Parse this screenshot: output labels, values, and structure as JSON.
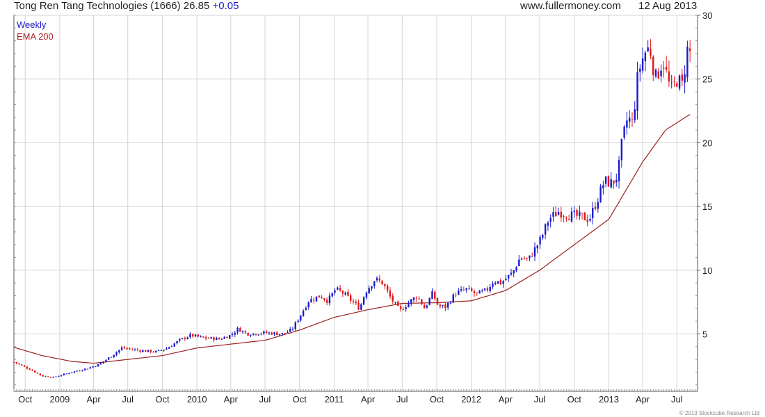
{
  "header": {
    "title": "Tong Ren Tang Technologies (1666) 26.85",
    "change": "+0.05",
    "website": "www.fullermoney.com",
    "date": "12 Aug 2013"
  },
  "legend": {
    "weekly": "Weekly",
    "ema": "EMA 200"
  },
  "copyright": "© 2013 Stockcube Research Ltd",
  "colors": {
    "up": "#1a1acc",
    "down": "#e01818",
    "ema": "#9a2020",
    "grid": "#d4d4d4"
  },
  "chart_data": {
    "type": "candlestick",
    "y_ticks": [
      5,
      10,
      15,
      20,
      25,
      30
    ],
    "ylim": [
      0.5,
      30
    ],
    "x_tick_labels": [
      "Oct",
      "2009",
      "Apr",
      "Jul",
      "Oct",
      "2010",
      "Apr",
      "Jul",
      "Oct",
      "2011",
      "Apr",
      "Jul",
      "Oct",
      "2012",
      "Apr",
      "Jul",
      "Oct",
      "2013",
      "Apr",
      "Jul"
    ],
    "x_tick_dates": [
      "2008-10-01",
      "2009-01-01",
      "2009-04-01",
      "2009-07-01",
      "2009-10-01",
      "2010-01-01",
      "2010-04-01",
      "2010-07-01",
      "2010-10-01",
      "2011-01-01",
      "2011-04-01",
      "2011-07-01",
      "2011-10-01",
      "2012-01-01",
      "2012-04-01",
      "2012-07-01",
      "2012-10-01",
      "2013-01-01",
      "2013-04-01",
      "2013-07-01"
    ],
    "xlim": [
      "2008-09-01",
      "2013-08-25"
    ],
    "grid": true,
    "price_keypoints": [
      [
        "2008-09-01",
        2.8
      ],
      [
        "2008-10-15",
        2.2
      ],
      [
        "2008-11-15",
        1.7
      ],
      [
        "2008-12-15",
        1.6
      ],
      [
        "2009-02-01",
        2.0
      ],
      [
        "2009-03-15",
        2.3
      ],
      [
        "2009-04-15",
        2.6
      ],
      [
        "2009-05-15",
        3.2
      ],
      [
        "2009-06-15",
        3.9
      ],
      [
        "2009-08-01",
        3.7
      ],
      [
        "2009-09-15",
        3.6
      ],
      [
        "2009-10-15",
        3.9
      ],
      [
        "2009-11-15",
        4.5
      ],
      [
        "2009-12-15",
        4.9
      ],
      [
        "2010-01-15",
        4.7
      ],
      [
        "2010-03-01",
        4.6
      ],
      [
        "2010-04-01",
        4.9
      ],
      [
        "2010-04-20",
        5.4
      ],
      [
        "2010-05-15",
        5.0
      ],
      [
        "2010-07-01",
        5.1
      ],
      [
        "2010-08-15",
        5.0
      ],
      [
        "2010-09-10",
        5.3
      ],
      [
        "2010-09-30",
        6.3
      ],
      [
        "2010-10-25",
        7.6
      ],
      [
        "2010-11-25",
        8.0
      ],
      [
        "2010-12-15",
        7.6
      ],
      [
        "2011-01-05",
        8.5
      ],
      [
        "2011-01-25",
        8.2
      ],
      [
        "2011-02-20",
        7.5
      ],
      [
        "2011-03-10",
        7.0
      ],
      [
        "2011-03-25",
        8.3
      ],
      [
        "2011-04-20",
        9.3
      ],
      [
        "2011-05-10",
        9.0
      ],
      [
        "2011-06-01",
        7.8
      ],
      [
        "2011-06-25",
        6.8
      ],
      [
        "2011-07-20",
        7.5
      ],
      [
        "2011-08-10",
        8.0
      ],
      [
        "2011-08-30",
        7.0
      ],
      [
        "2011-09-20",
        8.2
      ],
      [
        "2011-10-05",
        7.2
      ],
      [
        "2011-10-25",
        7.1
      ],
      [
        "2011-11-20",
        8.2
      ],
      [
        "2011-12-20",
        8.5
      ],
      [
        "2012-01-15",
        8.1
      ],
      [
        "2012-02-10",
        8.4
      ],
      [
        "2012-03-01",
        9.2
      ],
      [
        "2012-03-20",
        9.0
      ],
      [
        "2012-04-20",
        9.8
      ],
      [
        "2012-05-10",
        11.0
      ],
      [
        "2012-06-01",
        10.8
      ],
      [
        "2012-06-15",
        11.5
      ],
      [
        "2012-07-05",
        12.5
      ],
      [
        "2012-07-25",
        14.0
      ],
      [
        "2012-08-20",
        14.6
      ],
      [
        "2012-09-20",
        14.3
      ],
      [
        "2012-10-20",
        14.2
      ],
      [
        "2012-11-10",
        14.0
      ],
      [
        "2012-12-01",
        15.5
      ],
      [
        "2012-12-20",
        17.0
      ],
      [
        "2013-01-10",
        16.8
      ],
      [
        "2013-01-25",
        17.5
      ],
      [
        "2013-02-05",
        20.0
      ],
      [
        "2013-02-20",
        22.0
      ],
      [
        "2013-03-05",
        21.5
      ],
      [
        "2013-03-20",
        25.5
      ],
      [
        "2013-04-05",
        27.0
      ],
      [
        "2013-04-20",
        27.5
      ],
      [
        "2013-05-05",
        25.0
      ],
      [
        "2013-05-25",
        26.5
      ],
      [
        "2013-06-15",
        24.0
      ],
      [
        "2013-07-01",
        25.0
      ],
      [
        "2013-07-15",
        24.5
      ],
      [
        "2013-07-30",
        27.5
      ],
      [
        "2013-08-09",
        26.8
      ]
    ],
    "ema_keypoints": [
      [
        "2008-09-01",
        3.95
      ],
      [
        "2008-11-15",
        3.3
      ],
      [
        "2009-02-01",
        2.85
      ],
      [
        "2009-04-01",
        2.7
      ],
      [
        "2009-07-01",
        3.0
      ],
      [
        "2009-10-01",
        3.3
      ],
      [
        "2010-01-01",
        3.9
      ],
      [
        "2010-04-01",
        4.2
      ],
      [
        "2010-07-01",
        4.5
      ],
      [
        "2010-10-01",
        5.3
      ],
      [
        "2011-01-01",
        6.3
      ],
      [
        "2011-04-01",
        6.9
      ],
      [
        "2011-07-01",
        7.4
      ],
      [
        "2011-10-01",
        7.45
      ],
      [
        "2012-01-01",
        7.6
      ],
      [
        "2012-04-01",
        8.4
      ],
      [
        "2012-07-01",
        10.0
      ],
      [
        "2012-10-01",
        12.0
      ],
      [
        "2013-01-01",
        14.0
      ],
      [
        "2013-04-01",
        18.5
      ],
      [
        "2013-06-01",
        21.0
      ],
      [
        "2013-08-09",
        22.3
      ]
    ]
  }
}
